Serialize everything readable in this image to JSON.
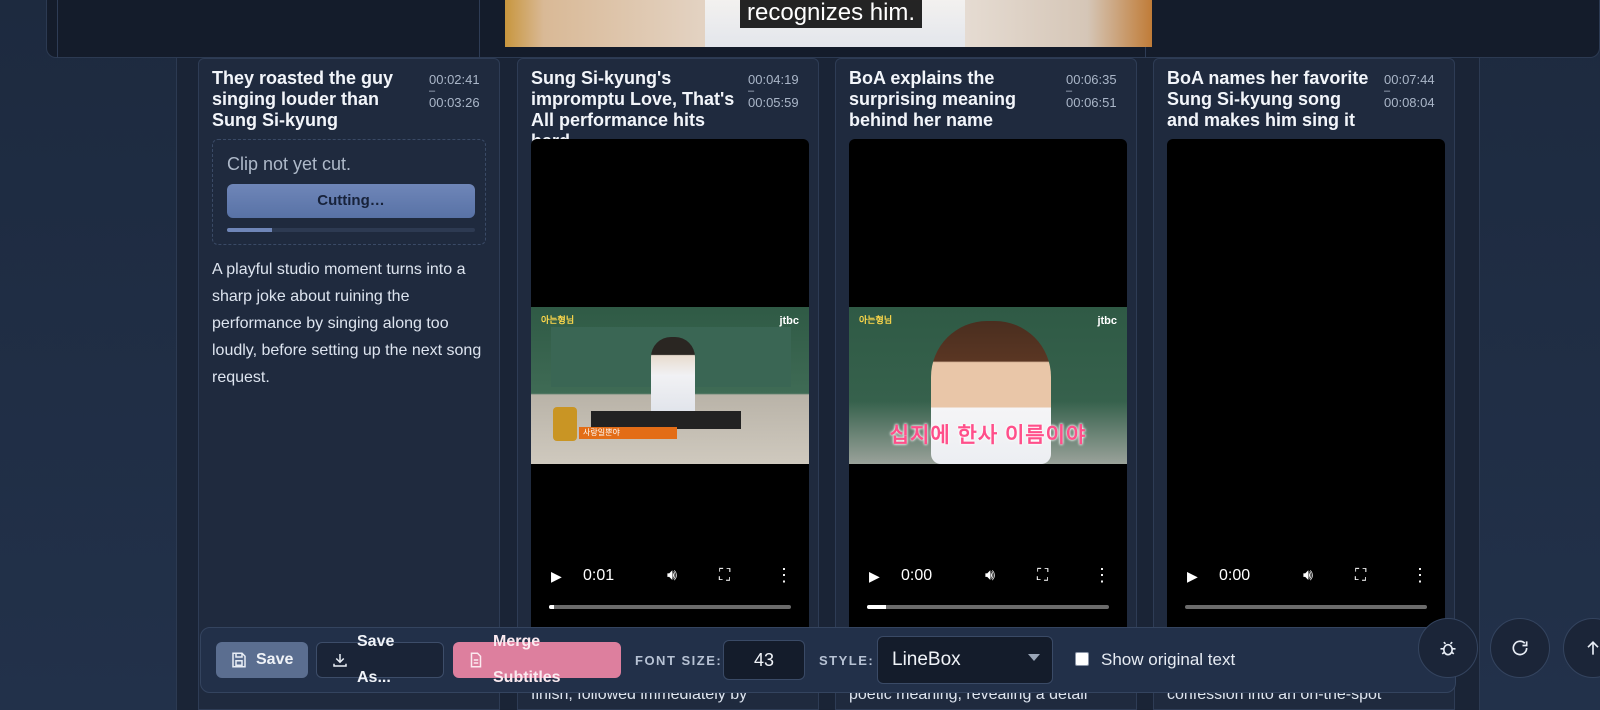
{
  "top_preview": {
    "caption": "recognizes him."
  },
  "clips": [
    {
      "title": "They roasted the guy singing louder than Sung Si-kyung",
      "start": "00:02:41",
      "separator": "–",
      "end": "00:03:26",
      "status": "Clip not yet cut.",
      "cutting_label": "Cutting…",
      "cut_progress": 0.18,
      "description": "A playful studio moment turns into a sharp joke about ruining the performance by singing along too loudly, before setting up the next song request."
    },
    {
      "title": "Sung Si-kyung's impromptu Love, That's All performance hits hard",
      "start": "00:04:19",
      "separator": "–",
      "end": "00:05:59",
      "player_time": "0:01",
      "playback_progress": 0.02,
      "description_visible": "finish, followed immediately by"
    },
    {
      "title": "BoA explains the surprising meaning behind her name",
      "start": "00:06:35",
      "separator": "–",
      "end": "00:06:51",
      "player_time": "0:00",
      "playback_progress": 0.08,
      "description_visible": "poetic meaning, revealing a detail"
    },
    {
      "title": "BoA names her favorite Sung Si-kyung song and makes him sing it",
      "start": "00:07:44",
      "separator": "–",
      "end": "00:08:04",
      "player_time": "0:00",
      "playback_progress": 0.0,
      "description_visible": "confession into an on-the-spot"
    }
  ],
  "video_overlays": {
    "show_logo": "아는형님",
    "network": "jtbc",
    "banner": "사랑일뿐야",
    "subtitle_ko": "십지에 한사 이름이야"
  },
  "toolbar": {
    "save_label": "Save",
    "save_as_label": "Save As...",
    "merge_label": "Merge Subtitles",
    "font_size_label": "FONT SIZE:",
    "font_size_value": "43",
    "style_label": "STYLE:",
    "style_value": "LineBox",
    "show_original_label": "Show original text",
    "show_original_checked": false
  },
  "icons": {
    "save": "floppy-disk-icon",
    "save_as": "download-icon",
    "merge": "document-icon",
    "bug": "bug-icon",
    "refresh": "refresh-icon",
    "up": "arrow-up-icon"
  },
  "colors": {
    "background": "#1d2a3f",
    "card": "#1f2a3e",
    "accent_blue": "#5b6e90",
    "accent_pink": "#dd7f9e"
  }
}
